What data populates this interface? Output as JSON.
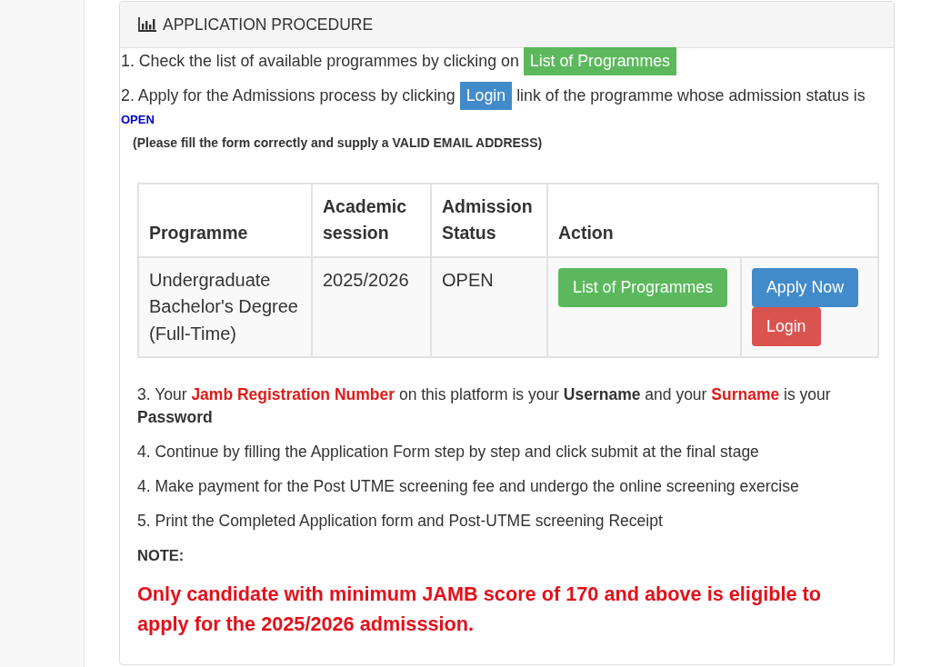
{
  "panel": {
    "title": "APPLICATION PROCEDURE",
    "intro_steps": [
      {
        "segments": [
          {
            "kind": "text",
            "text": "1. Check the list of available programmes by clicking on"
          },
          {
            "kind": "button",
            "label": "List of Programmes",
            "color": "#5cb85c"
          }
        ]
      },
      {
        "segments": [
          {
            "kind": "text",
            "text": "2. Apply for the Admissions process by clicking"
          },
          {
            "kind": "button",
            "label": "Login",
            "color": "#428bca"
          },
          {
            "kind": "text",
            "text": "link of the programme whose admission status is"
          },
          {
            "kind": "status",
            "text": "OPEN"
          }
        ]
      }
    ],
    "form_note": "(Please fill the form correctly and supply a VALID EMAIL ADDRESS)",
    "table": {
      "columns": [
        "Programme",
        "Academic session",
        "Admission Status",
        "Action"
      ],
      "rows": [
        {
          "programme": "Undergraduate Bachelor's Degree (Full-Time)",
          "session": "2025/2026",
          "status": "OPEN",
          "action_groups": [
            [
              {
                "label": "List of Programmes",
                "color": "#5cb85c"
              }
            ],
            [
              {
                "label": "Apply Now",
                "color": "#428bca"
              },
              {
                "label": "Login",
                "color": "#d9534f"
              }
            ]
          ]
        }
      ]
    },
    "steps": [
      {
        "segments": [
          {
            "kind": "plain",
            "text": "3. Your "
          },
          {
            "kind": "highlight",
            "text": "Jamb Registration Number"
          },
          {
            "kind": "plain",
            "text": " on this platform is your "
          },
          {
            "kind": "strong",
            "text": "Username"
          },
          {
            "kind": "plain",
            "text": " and your "
          },
          {
            "kind": "highlight",
            "text": "Surname"
          },
          {
            "kind": "plain",
            "text": " is your "
          },
          {
            "kind": "strong",
            "text": "Password"
          }
        ]
      },
      {
        "segments": [
          {
            "kind": "plain",
            "text": "4. Continue by filling the Application Form step by step and click submit at the final stage"
          }
        ]
      },
      {
        "segments": [
          {
            "kind": "plain",
            "text": "4. Make payment for the Post UTME screening fee and undergo the online screening exercise"
          }
        ]
      },
      {
        "segments": [
          {
            "kind": "plain",
            "text": "5. Print the Completed Application form and Post-UTME screening Receipt"
          }
        ]
      }
    ],
    "note_label": "NOTE:",
    "note": "Only candidate with minimum JAMB score of 170 and above is eligible to apply for the 2025/2026 admisssion."
  }
}
